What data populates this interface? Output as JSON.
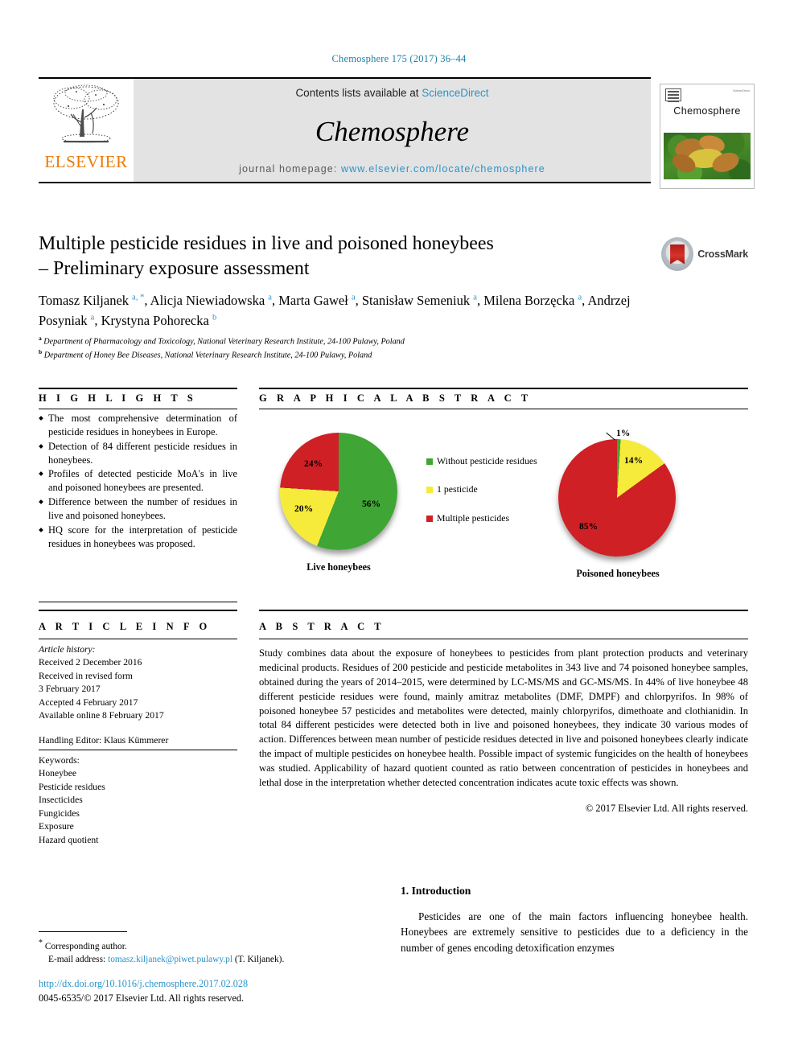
{
  "running_head": "Chemosphere 175 (2017) 36–44",
  "masthead": {
    "contents_text": "Contents lists available at ",
    "sciencedirect": "ScienceDirect",
    "journal_name": "Chemosphere",
    "homepage_label": "journal homepage: ",
    "homepage_url": "www.elsevier.com/locate/chemosphere",
    "publisher": "ELSEVIER",
    "cover_title": "Chemosphere",
    "cover_corner_text": "ScienceDirect"
  },
  "crossmark": {
    "label": "CrossMark"
  },
  "article": {
    "title_line1": "Multiple pesticide residues in live and poisoned honeybees",
    "title_line2": "– Preliminary exposure assessment",
    "authors": [
      {
        "name": "Tomasz Kiljanek",
        "marks": "a, *"
      },
      {
        "name": "Alicja Niewiadowska",
        "marks": "a"
      },
      {
        "name": "Marta Gaweł",
        "marks": "a"
      },
      {
        "name": "Stanisław Semeniuk",
        "marks": "a"
      },
      {
        "name": "Milena Borzęcka",
        "marks": "a"
      },
      {
        "name": "Andrzej Posyniak",
        "marks": "a"
      },
      {
        "name": "Krystyna Pohorecka",
        "marks": "b"
      }
    ],
    "affiliations": [
      {
        "mark": "a",
        "text": "Department of Pharmacology and Toxicology, National Veterinary Research Institute, 24-100 Pulawy, Poland"
      },
      {
        "mark": "b",
        "text": "Department of Honey Bee Diseases, National Veterinary Research Institute, 24-100 Pulawy, Poland"
      }
    ]
  },
  "highlights": {
    "heading": "H I G H L I G H T S",
    "items": [
      "The most comprehensive determination of pesticide residues in honeybees in Europe.",
      "Detection of 84 different pesticide residues in honeybees.",
      "Profiles of detected pesticide MoA's in live and poisoned honeybees are presented.",
      "Difference between the number of residues in live and poisoned honeybees.",
      "HQ score for the interpretation of pesticide residues in honeybees was proposed."
    ]
  },
  "graphical_abstract": {
    "heading": "G R A P H I C A L   A B S T R A C T"
  },
  "chart_data": [
    {
      "type": "pie",
      "title": "Live honeybees",
      "categories": [
        "Without pesticide residues",
        "1 pesticide",
        "Multiple pesticides"
      ],
      "values": [
        56,
        20,
        24
      ],
      "labels": [
        "56%",
        "20%",
        "24%"
      ],
      "colors": [
        "#3fa535",
        "#f6eb3b",
        "#cf2026"
      ],
      "legend_position": "right"
    },
    {
      "type": "pie",
      "title": "Poisoned honeybees",
      "categories": [
        "Without pesticide residues",
        "1 pesticide",
        "Multiple pesticides"
      ],
      "values": [
        1,
        14,
        85
      ],
      "labels": [
        "1%",
        "14%",
        "85%"
      ],
      "colors": [
        "#3fa535",
        "#f6eb3b",
        "#cf2026"
      ],
      "legend_position": "right"
    }
  ],
  "legend": {
    "entries": [
      {
        "label": "Without pesticide residues",
        "color": "#3fa535"
      },
      {
        "label": "1 pesticide",
        "color": "#f6eb3b"
      },
      {
        "label": "Multiple pesticides",
        "color": "#cf2026"
      }
    ]
  },
  "article_info": {
    "heading": "A R T I C L E   I N F O",
    "history_label": "Article history:",
    "history": [
      "Received 2 December 2016",
      "Received in revised form",
      "3 February 2017",
      "Accepted 4 February 2017",
      "Available online 8 February 2017"
    ],
    "handling_editor": "Handling Editor: Klaus Kümmerer",
    "keywords_label": "Keywords:",
    "keywords": [
      "Honeybee",
      "Pesticide residues",
      "Insecticides",
      "Fungicides",
      "Exposure",
      "Hazard quotient"
    ]
  },
  "abstract": {
    "heading": "A B S T R A C T",
    "body": "Study combines data about the exposure of honeybees to pesticides from plant protection products and veterinary medicinal products. Residues of 200 pesticide and pesticide metabolites in 343 live and 74 poisoned honeybee samples, obtained during the years of 2014–2015, were determined by LC-MS/MS and GC-MS/MS. In 44% of live honeybee 48 different pesticide residues were found, mainly amitraz metabolites (DMF, DMPF) and chlorpyrifos. In 98% of poisoned honeybee 57 pesticides and metabolites were detected, mainly chlorpyrifos, dimethoate and clothianidin. In total 84 different pesticides were detected both in live and poisoned honeybees, they indicate 30 various modes of action. Differences between mean number of pesticide residues detected in live and poisoned honeybees clearly indicate the impact of multiple pesticides on honeybee health. Possible impact of systemic fungicides on the health of honeybees was studied. Applicability of hazard quotient counted as ratio between concentration of pesticides in honeybees and lethal dose in the interpretation whether detected concentration indicates acute toxic effects was shown.",
    "copyright": "© 2017 Elsevier Ltd. All rights reserved."
  },
  "introduction": {
    "heading": "1. Introduction",
    "body": "Pesticides are one of the main factors influencing honeybee health. Honeybees are extremely sensitive to pesticides due to a deficiency in the number of genes encoding detoxification enzymes"
  },
  "footer": {
    "corresponding_label": "Corresponding author.",
    "email_label": "E-mail address:",
    "email": "tomasz.kiljanek@piwet.pulawy.pl",
    "email_owner": "(T. Kiljanek).",
    "doi": "http://dx.doi.org/10.1016/j.chemosphere.2017.02.028",
    "issn_line": "0045-6535/© 2017 Elsevier Ltd. All rights reserved."
  }
}
